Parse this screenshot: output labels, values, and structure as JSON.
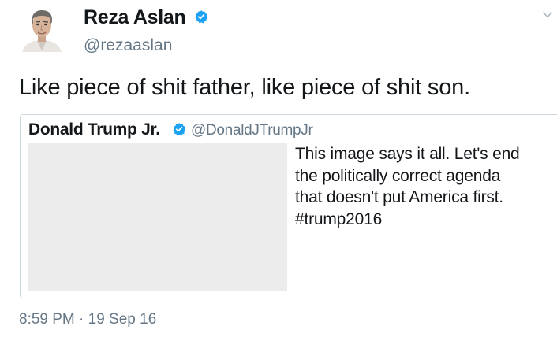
{
  "tweet": {
    "author": {
      "name": "Reza Aslan",
      "handle": "@rezaaslan",
      "verified": true
    },
    "text": "Like piece of shit father, like piece of shit son.",
    "timestamp": "8:59 PM · 19 Sep 16",
    "menu_icon": "chevron-down-icon"
  },
  "quoted_tweet": {
    "author": {
      "name": "Donald Trump Jr.",
      "handle": "@DonaldJTrumpJr",
      "verified": true
    },
    "text_lines": [
      "This image says it all. Let's end",
      "the politically correct agenda",
      "that doesn't put America first.",
      "#trump2016"
    ]
  },
  "colors": {
    "verified_blue": "#1da1f2",
    "secondary_text": "#657786",
    "border": "#ccd6dd",
    "image_placeholder": "#ececec"
  }
}
